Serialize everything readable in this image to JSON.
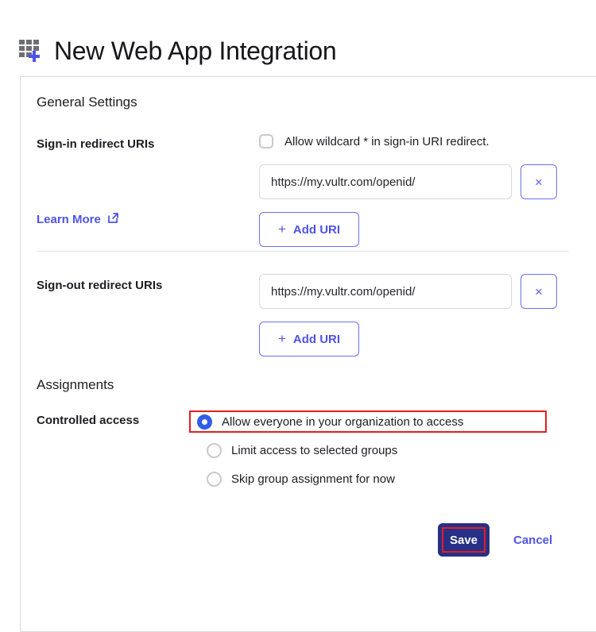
{
  "header": {
    "title": "New Web App Integration",
    "icon": "app-grid-plus-icon"
  },
  "card": {
    "general_settings_heading": "General Settings",
    "assignments_heading": "Assignments",
    "signin": {
      "label": "Sign-in redirect URIs",
      "wildcard_checkbox_label": "Allow wildcard * in sign-in URI redirect.",
      "wildcard_checked": false,
      "uri_value": "https://my.vultr.com/openid/",
      "uri_placeholder": "https://",
      "remove_label": "×",
      "add_uri_label": "Add URI",
      "add_uri_plus": "+",
      "learn_more_label": "Learn More"
    },
    "signout": {
      "label": "Sign-out redirect URIs",
      "uri_value": "https://my.vultr.com/openid/",
      "uri_placeholder": "https://",
      "remove_label": "×",
      "add_uri_label": "Add URI",
      "add_uri_plus": "+"
    },
    "controlled_access": {
      "label": "Controlled access",
      "options": [
        {
          "label": "Allow everyone in your organization to access",
          "selected": true
        },
        {
          "label": "Limit access to selected groups",
          "selected": false
        },
        {
          "label": "Skip group assignment for now",
          "selected": false
        }
      ]
    },
    "footer": {
      "save_label": "Save",
      "cancel_label": "Cancel"
    }
  },
  "colors": {
    "accent": "#4f54e0",
    "accent_border": "#6b6ff0",
    "radio_selected": "#2f5ee8",
    "save_bg": "#273086",
    "highlight": "#e02020",
    "text": "#1d1d21",
    "border": "#d9d9de"
  }
}
